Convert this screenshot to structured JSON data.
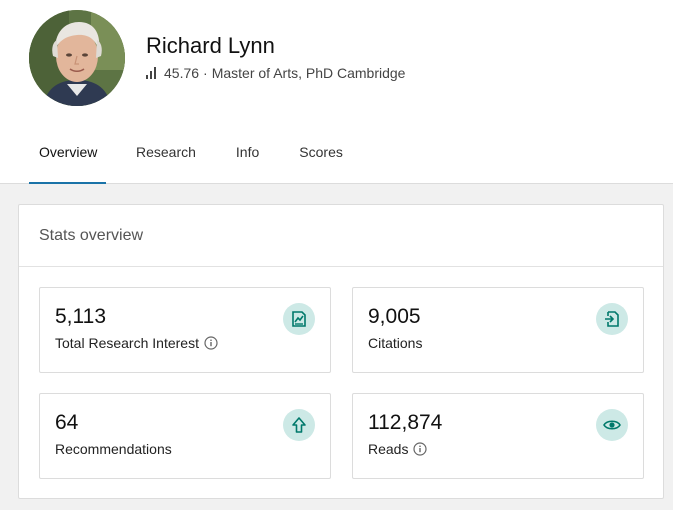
{
  "profile": {
    "name": "Richard Lynn",
    "score": "45.76",
    "separator": "·",
    "degree": "Master of Arts, PhD Cambridge"
  },
  "tabs": [
    {
      "label": "Overview",
      "active": true
    },
    {
      "label": "Research",
      "active": false
    },
    {
      "label": "Info",
      "active": false
    },
    {
      "label": "Scores",
      "active": false
    }
  ],
  "stats_card": {
    "title": "Stats overview",
    "items": [
      {
        "value": "5,113",
        "label": "Total Research Interest",
        "icon": "research-interest-icon",
        "has_info": true
      },
      {
        "value": "9,005",
        "label": "Citations",
        "icon": "citations-icon",
        "has_info": false
      },
      {
        "value": "64",
        "label": "Recommendations",
        "icon": "recommendation-arrow-icon",
        "has_info": false
      },
      {
        "value": "112,874",
        "label": "Reads",
        "icon": "eye-icon",
        "has_info": true
      }
    ]
  },
  "colors": {
    "accent": "#1a73a8",
    "badge_bg": "#cde9e6",
    "badge_icon": "#00796b"
  }
}
